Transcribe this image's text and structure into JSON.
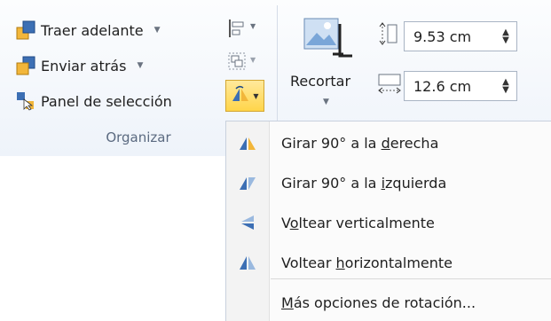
{
  "ribbon": {
    "group_label": "Organizar",
    "bring_forward": "Traer adelante",
    "send_backward": "Enviar atrás",
    "selection_pane": "Panel de selección",
    "crop_label": "Recortar",
    "height_value": "9.53 cm",
    "width_value": "12.6 cm"
  },
  "rotate_menu": {
    "items": [
      {
        "pre": "Girar 90° a la ",
        "key": "d",
        "post": "erecha",
        "icon": "rotate-right-icon"
      },
      {
        "pre": "Girar 90° a la ",
        "key": "i",
        "post": "zquierda",
        "icon": "rotate-left-icon"
      },
      {
        "pre": "V",
        "key": "o",
        "post": "ltear verticalmente",
        "icon": "flip-vertical-icon"
      },
      {
        "pre": "Voltear ",
        "key": "h",
        "post": "orizontalmente",
        "icon": "flip-horizontal-icon"
      },
      {
        "pre": "",
        "key": "M",
        "post": "ás opciones de rotación...",
        "icon": ""
      }
    ]
  },
  "colors": {
    "accent_highlight": "#ffd54a",
    "icon_blue": "#3c6fb4",
    "icon_yellow": "#f2b63a"
  }
}
